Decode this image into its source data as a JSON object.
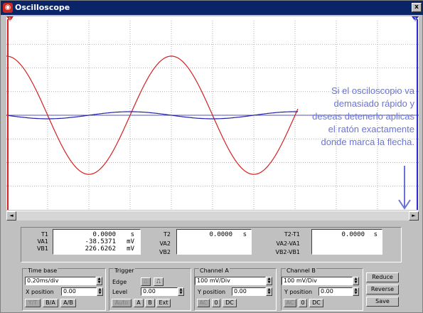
{
  "window": {
    "title": "Oscilloscope",
    "close_label": "x"
  },
  "scope": {
    "marker_t1": "1",
    "marker_t2": "2",
    "annotation": "Si el osciloscopio va demasiado rápido y deseas detenerlo aplicas el ratón exactamente donde marca la flecha.",
    "colors": {
      "channel_a": "#d42020",
      "channel_b": "#2020a8",
      "cursor": "#2828d8",
      "annotation": "#6a74d8",
      "grid": "#9a9a9a"
    },
    "trace_a": {
      "amplitude_mv": 250,
      "period_ms": 0.8
    },
    "trace_b": {
      "amplitude_mv": 15,
      "period_ms": 0.8
    }
  },
  "scrollbar": {
    "left_arrow": "◄",
    "right_arrow": "►"
  },
  "readout": {
    "t1": {
      "label": "T1",
      "value": "0.0000",
      "unit": "s"
    },
    "va1": {
      "label": "VA1",
      "value": "-38.5371",
      "unit": "mV"
    },
    "vb1": {
      "label": "VB1",
      "value": "226.6262",
      "unit": "mV"
    },
    "t2": {
      "label": "T2",
      "value": "0.0000",
      "unit": "s"
    },
    "va2": {
      "label": "VA2"
    },
    "vb2": {
      "label": "VB2"
    },
    "t2t1": {
      "label": "T2-T1",
      "value": "0.0000",
      "unit": "s"
    },
    "va2va1": {
      "label": "VA2-VA1"
    },
    "vb2vb1": {
      "label": "VB2-VB1"
    }
  },
  "timebase": {
    "title": "Time base",
    "value": "0.20ms/div",
    "xpos_label": "X position",
    "xpos_value": "0.00",
    "yt": "Y/T",
    "ba": "B/A",
    "ab": "A/B"
  },
  "trigger": {
    "title": "Trigger",
    "edge_label": "Edge",
    "level_label": "Level",
    "level_value": "0.00",
    "auto": "Auto",
    "a": "A",
    "b": "B",
    "ext": "Ext"
  },
  "channel_a": {
    "title": "Channel A",
    "value": "100 mV/Div",
    "ypos_label": "Y position",
    "ypos_value": "0.00",
    "ac": "AC",
    "zero": "0",
    "dc": "DC"
  },
  "channel_b": {
    "title": "Channel B",
    "value": "100 mV/Div",
    "ypos_label": "Y position",
    "ypos_value": "0.00",
    "ac": "AC",
    "zero": "0",
    "dc": "DC"
  },
  "buttons": {
    "reduce": "Reduce",
    "reverse": "Reverse",
    "save": "Save"
  }
}
